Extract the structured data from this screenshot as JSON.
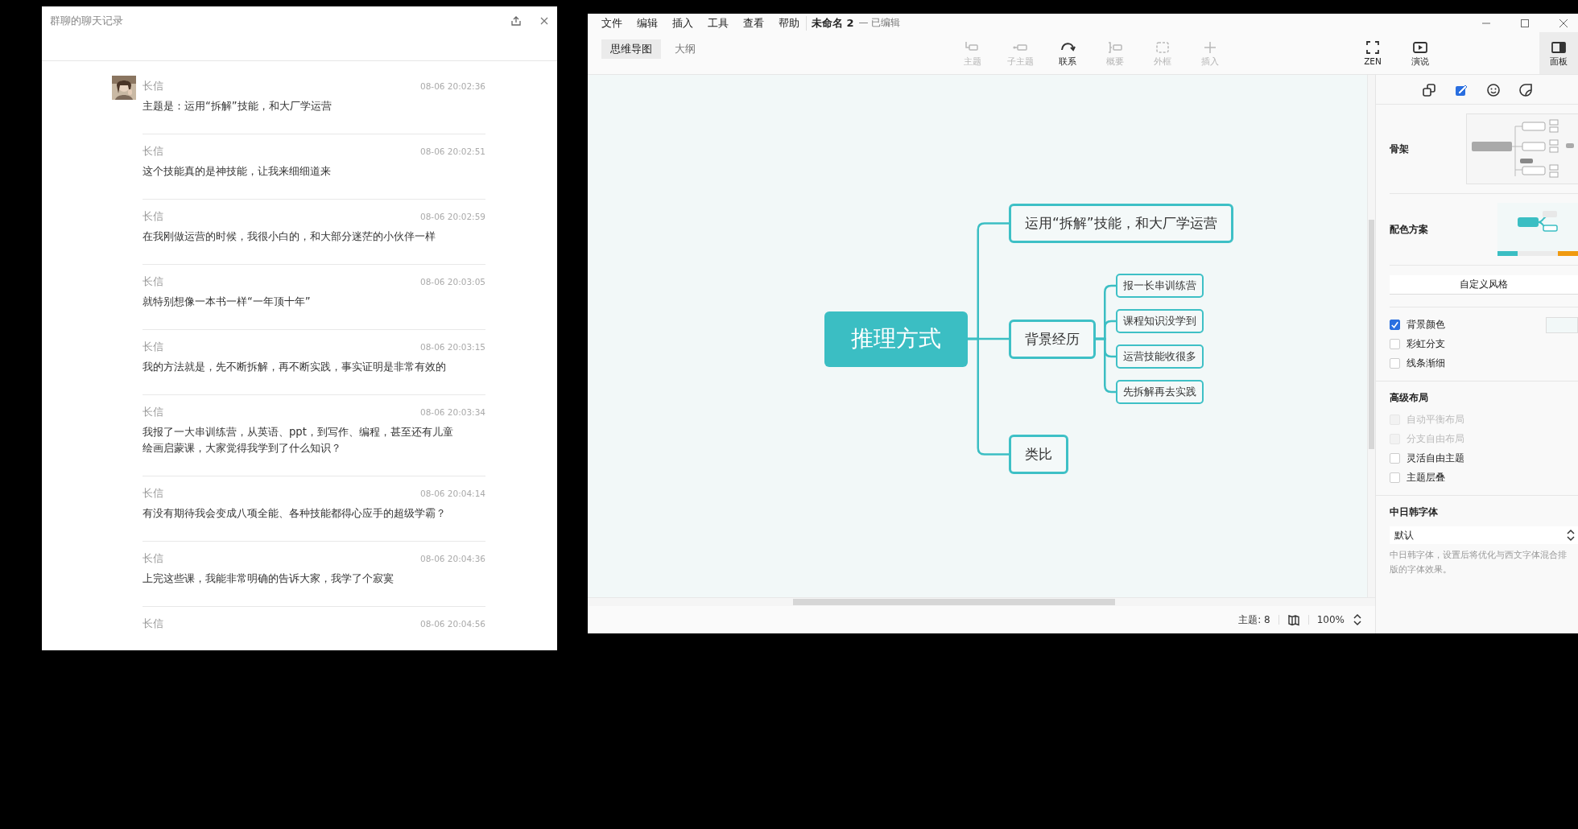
{
  "chat_window": {
    "title": "群聊的聊天记录",
    "messages": [
      {
        "sender": "长信",
        "time": "08-06 20:02:36",
        "text": "主题是：运用“拆解”技能，和大厂学运营",
        "avatar": true
      },
      {
        "sender": "长信",
        "time": "08-06 20:02:51",
        "text": "这个技能真的是神技能，让我来细细道来",
        "avatar": false
      },
      {
        "sender": "长信",
        "time": "08-06 20:02:59",
        "text": "在我刚做运营的时候，我很小白的，和大部分迷茫的小伙伴一样",
        "avatar": false
      },
      {
        "sender": "长信",
        "time": "08-06 20:03:05",
        "text": "就特别想像一本书一样“一年顶十年”",
        "avatar": false
      },
      {
        "sender": "长信",
        "time": "08-06 20:03:15",
        "text": "我的方法就是，先不断拆解，再不断实践，事实证明是非常有效的",
        "avatar": false
      },
      {
        "sender": "长信",
        "time": "08-06 20:03:34",
        "text": "我报了一大串训练营，从英语、ppt，到写作、编程，甚至还有儿童绘画启蒙课，大家觉得我学到了什么知识？",
        "avatar": false
      },
      {
        "sender": "长信",
        "time": "08-06 20:04:14",
        "text": "有没有期待我会变成八项全能、各种技能都得心应手的超级学霸？",
        "avatar": false
      },
      {
        "sender": "长信",
        "time": "08-06 20:04:36",
        "text": "上完这些课，我能非常明确的告诉大家，我学了个寂寞",
        "avatar": false
      },
      {
        "sender": "长信",
        "time": "08-06 20:04:56",
        "avatar": false
      }
    ]
  },
  "mindmap_window": {
    "menu": [
      "文件",
      "编辑",
      "插入",
      "工具",
      "查看",
      "帮助"
    ],
    "document_title": "未命名 2",
    "document_status": "— 已编辑",
    "view_tabs": [
      {
        "label": "思维导图",
        "selected": true
      },
      {
        "label": "大纲",
        "selected": false
      }
    ],
    "tools": [
      {
        "kind": "topic",
        "label": "主题",
        "disabled": true
      },
      {
        "kind": "subtopic",
        "label": "子主题",
        "disabled": true
      },
      {
        "kind": "relationship",
        "label": "联系",
        "disabled": false
      },
      {
        "kind": "summary",
        "label": "概要",
        "disabled": true
      },
      {
        "kind": "boundary",
        "label": "外框",
        "disabled": true
      },
      {
        "kind": "insert",
        "label": "插入",
        "disabled": true
      }
    ],
    "right_tools": [
      {
        "kind": "zen",
        "label": "ZEN"
      },
      {
        "kind": "pitch",
        "label": "演说"
      }
    ],
    "panel_toggle": {
      "label": "面板",
      "selected": true
    },
    "mindmap": {
      "central": "推理方式",
      "branches": [
        {
          "text": "运用“拆解”技能，和大厂学运营"
        },
        {
          "text": "背景经历",
          "children": [
            {
              "text": "报一长串训练营"
            },
            {
              "text": "课程知识没学到"
            },
            {
              "text": "运营技能收很多"
            },
            {
              "text": "先拆解再去实践"
            }
          ]
        },
        {
          "text": "类比"
        }
      ]
    },
    "status_bar": {
      "topic_count": "主题: 8",
      "zoom": "100%"
    },
    "panel": {
      "tabs": [
        {
          "kind": "shape",
          "selected": false
        },
        {
          "kind": "style",
          "selected": true
        },
        {
          "kind": "emoji",
          "selected": false
        },
        {
          "kind": "sticker",
          "selected": false
        }
      ],
      "skeleton_label": "骨架",
      "color_scheme_label": "配色方案",
      "custom_style_button": "自定义风格",
      "options": [
        {
          "label": "背景颜色",
          "checked": true,
          "disabled": false
        },
        {
          "label": "彩虹分支",
          "checked": false,
          "disabled": false
        },
        {
          "label": "线条渐细",
          "checked": false,
          "disabled": false
        }
      ],
      "advanced_heading": "高级布局",
      "advanced_options": [
        {
          "label": "自动平衡布局",
          "checked": false,
          "disabled": true
        },
        {
          "label": "分支自由布局",
          "checked": false,
          "disabled": true
        },
        {
          "label": "灵活自由主题",
          "checked": false,
          "disabled": false
        },
        {
          "label": "主题层叠",
          "checked": false,
          "disabled": false
        }
      ],
      "cjk_font_heading": "中日韩字体",
      "cjk_font_value": "默认",
      "cjk_font_note": "中日韩字体，设置后将优化与西文字体混合排版的字体效果。"
    }
  }
}
